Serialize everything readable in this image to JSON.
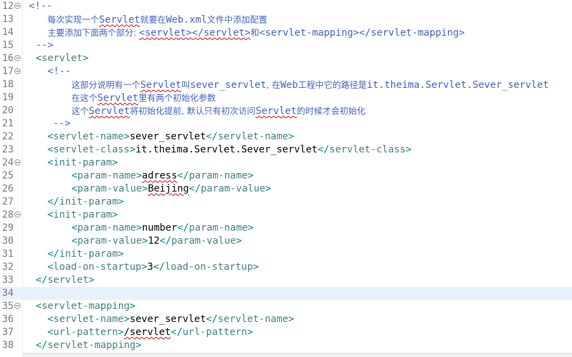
{
  "editor": {
    "lines": [
      {
        "num": "12",
        "fold": true,
        "tokens": [
          {
            "t": "<!--",
            "c": "cm"
          }
        ]
      },
      {
        "num": "13",
        "tokens": [
          {
            "t": "每次实现一个",
            "c": "cmz"
          },
          {
            "t": "Servlet",
            "c": "cm",
            "sq": true
          },
          {
            "t": "就要在",
            "c": "cmz"
          },
          {
            "t": "Web.xml",
            "c": "cm"
          },
          {
            "t": "文件中添加配置",
            "c": "cmz"
          }
        ]
      },
      {
        "num": "14",
        "tokens": [
          {
            "t": "主要添加下面两个部分: ",
            "c": "cmz"
          },
          {
            "t": "<servlet></servlet>",
            "c": "cm",
            "sq": true
          },
          {
            "t": "和",
            "c": "cmz"
          },
          {
            "t": "<servlet-mapping></servlet-mapping>",
            "c": "cm"
          }
        ]
      },
      {
        "num": "15",
        "tokens": [
          {
            "t": "-->",
            "c": "cm"
          }
        ]
      },
      {
        "num": "16",
        "fold": true,
        "tokens": [
          {
            "t": "<",
            "c": "br"
          },
          {
            "t": "servlet",
            "c": "tag"
          },
          {
            "t": ">",
            "c": "br"
          }
        ]
      },
      {
        "num": "17",
        "fold": true,
        "tokens": [
          {
            "t": "<!--",
            "c": "cm"
          }
        ]
      },
      {
        "num": "18",
        "tokens": [
          {
            "t": "这部分说明有一个",
            "c": "cmz"
          },
          {
            "t": "Servlet",
            "c": "cm",
            "sq": true
          },
          {
            "t": "叫",
            "c": "cmz"
          },
          {
            "t": "sever_servlet",
            "c": "cm"
          },
          {
            "t": ", 在",
            "c": "cmz"
          },
          {
            "t": "Web",
            "c": "cm"
          },
          {
            "t": "工程中它的路径是",
            "c": "cmz"
          },
          {
            "t": "it.theima.Servlet.Sever_servlet",
            "c": "cm"
          }
        ]
      },
      {
        "num": "19",
        "tokens": [
          {
            "t": "在这个",
            "c": "cmz"
          },
          {
            "t": "Servlet",
            "c": "cm",
            "sq": true
          },
          {
            "t": "里有两个初始化参数",
            "c": "cmz"
          }
        ]
      },
      {
        "num": "20",
        "tokens": [
          {
            "t": "这个",
            "c": "cmz"
          },
          {
            "t": "Servlet",
            "c": "cm",
            "sq": true
          },
          {
            "t": "将初始化提前, 默认只有初次访问",
            "c": "cmz"
          },
          {
            "t": "Servlet",
            "c": "cm",
            "sq": true
          },
          {
            "t": "的时候才会初始化",
            "c": "cmz"
          }
        ]
      },
      {
        "num": "21",
        "tokens": [
          {
            "t": "-->",
            "c": "cm"
          }
        ]
      },
      {
        "num": "22",
        "tokens": [
          {
            "t": "<",
            "c": "br"
          },
          {
            "t": "servlet-name",
            "c": "tag"
          },
          {
            "t": ">",
            "c": "br"
          },
          {
            "t": "sever_servlet",
            "c": "txt"
          },
          {
            "t": "</",
            "c": "br"
          },
          {
            "t": "servlet-name",
            "c": "tag"
          },
          {
            "t": ">",
            "c": "br"
          }
        ]
      },
      {
        "num": "23",
        "tokens": [
          {
            "t": "<",
            "c": "br"
          },
          {
            "t": "servlet-class",
            "c": "tag"
          },
          {
            "t": ">",
            "c": "br"
          },
          {
            "t": "it.theima.Servlet.Sever_servlet",
            "c": "txt"
          },
          {
            "t": "</",
            "c": "br"
          },
          {
            "t": "servlet-class",
            "c": "tag"
          },
          {
            "t": ">",
            "c": "br"
          }
        ]
      },
      {
        "num": "24",
        "fold": true,
        "tokens": [
          {
            "t": "<",
            "c": "br"
          },
          {
            "t": "init-param",
            "c": "tag"
          },
          {
            "t": ">",
            "c": "br"
          }
        ]
      },
      {
        "num": "25",
        "tokens": [
          {
            "t": "<",
            "c": "br"
          },
          {
            "t": "param-name",
            "c": "tag"
          },
          {
            "t": ">",
            "c": "br"
          },
          {
            "t": "adress",
            "c": "txt",
            "sq": true
          },
          {
            "t": "</",
            "c": "br"
          },
          {
            "t": "param-name",
            "c": "tag"
          },
          {
            "t": ">",
            "c": "br"
          }
        ]
      },
      {
        "num": "26",
        "tokens": [
          {
            "t": "<",
            "c": "br"
          },
          {
            "t": "param-value",
            "c": "tag"
          },
          {
            "t": ">",
            "c": "br"
          },
          {
            "t": "Beijing",
            "c": "txt",
            "sq": true
          },
          {
            "t": "</",
            "c": "br"
          },
          {
            "t": "param-value",
            "c": "tag"
          },
          {
            "t": ">",
            "c": "br"
          }
        ]
      },
      {
        "num": "27",
        "tokens": [
          {
            "t": "</",
            "c": "br"
          },
          {
            "t": "init-param",
            "c": "tag"
          },
          {
            "t": ">",
            "c": "br"
          }
        ]
      },
      {
        "num": "28",
        "fold": true,
        "tokens": [
          {
            "t": "<",
            "c": "br"
          },
          {
            "t": "init-param",
            "c": "tag"
          },
          {
            "t": ">",
            "c": "br"
          }
        ]
      },
      {
        "num": "29",
        "tokens": [
          {
            "t": "<",
            "c": "br"
          },
          {
            "t": "param-name",
            "c": "tag"
          },
          {
            "t": ">",
            "c": "br"
          },
          {
            "t": "number",
            "c": "txt"
          },
          {
            "t": "</",
            "c": "br"
          },
          {
            "t": "param-name",
            "c": "tag"
          },
          {
            "t": ">",
            "c": "br"
          }
        ]
      },
      {
        "num": "30",
        "tokens": [
          {
            "t": "<",
            "c": "br"
          },
          {
            "t": "param-value",
            "c": "tag"
          },
          {
            "t": ">",
            "c": "br"
          },
          {
            "t": "12",
            "c": "txt"
          },
          {
            "t": "</",
            "c": "br"
          },
          {
            "t": "param-value",
            "c": "tag"
          },
          {
            "t": ">",
            "c": "br"
          }
        ]
      },
      {
        "num": "31",
        "tokens": [
          {
            "t": "</",
            "c": "br"
          },
          {
            "t": "init-param",
            "c": "tag"
          },
          {
            "t": ">",
            "c": "br"
          }
        ]
      },
      {
        "num": "32",
        "tokens": [
          {
            "t": "<",
            "c": "br"
          },
          {
            "t": "load-on-startup",
            "c": "tag"
          },
          {
            "t": ">",
            "c": "br"
          },
          {
            "t": "3",
            "c": "txt"
          },
          {
            "t": "</",
            "c": "br"
          },
          {
            "t": "load-on-startup",
            "c": "tag"
          },
          {
            "t": ">",
            "c": "br"
          }
        ]
      },
      {
        "num": "33",
        "tokens": [
          {
            "t": "</",
            "c": "br"
          },
          {
            "t": "servlet",
            "c": "tag"
          },
          {
            "t": ">",
            "c": "br"
          }
        ]
      },
      {
        "num": "34",
        "current": true,
        "tokens": []
      },
      {
        "num": "35",
        "fold": true,
        "tokens": [
          {
            "t": "<",
            "c": "br"
          },
          {
            "t": "servlet-mapping",
            "c": "tag"
          },
          {
            "t": ">",
            "c": "br"
          }
        ]
      },
      {
        "num": "36",
        "tokens": [
          {
            "t": "<",
            "c": "br"
          },
          {
            "t": "servlet-name",
            "c": "tag"
          },
          {
            "t": ">",
            "c": "br"
          },
          {
            "t": "sever_servlet",
            "c": "txt"
          },
          {
            "t": "</",
            "c": "br"
          },
          {
            "t": "servlet-name",
            "c": "tag"
          },
          {
            "t": ">",
            "c": "br"
          }
        ]
      },
      {
        "num": "37",
        "tokens": [
          {
            "t": "<",
            "c": "br"
          },
          {
            "t": "url-pattern",
            "c": "tag"
          },
          {
            "t": ">",
            "c": "br"
          },
          {
            "t": "/servlet",
            "c": "txt",
            "sq": true
          },
          {
            "t": "</",
            "c": "br"
          },
          {
            "t": "url-pattern",
            "c": "tag"
          },
          {
            "t": ">",
            "c": "br"
          }
        ]
      },
      {
        "num": "38",
        "tokens": [
          {
            "t": "</",
            "c": "br"
          },
          {
            "t": "servlet-mapping",
            "c": "tag"
          },
          {
            "t": ">",
            "c": "br"
          }
        ]
      }
    ]
  }
}
